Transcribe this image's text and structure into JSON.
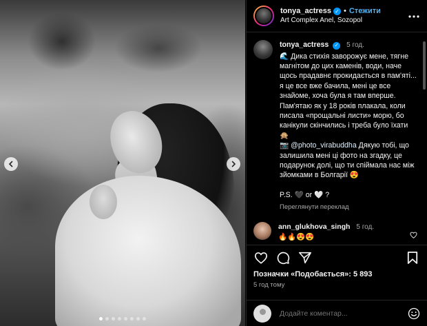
{
  "header": {
    "username": "tonya_actress",
    "separator": "•",
    "follow_label": "Стежити",
    "location": "Art Complex Anel, Sozopol",
    "more_icon": "more-horizontal-icon"
  },
  "carousel": {
    "prev_icon": "chevron-left-icon",
    "next_icon": "chevron-right-icon",
    "slide_count": 8,
    "active_index": 0
  },
  "caption": {
    "username": "tonya_actress",
    "time": "5 год.",
    "text_before_mention": "🌊 Дика стихія заворожує мене, тягне магнітом до цих каменів, води, наче щось прадавнє прокидається в пам'яті... я це все вже бачила, мені це все знайоме, хоча була я там вперше.\nПам'ятаю як у 18 років плакала, коли писала «прощальні листи» морю, бо канікули скінчились і треба було їхати 🙊\n📷 ",
    "mention": "@photo_virabuddha",
    "text_after_mention": " Дякую тобі, що залишила мені ці фото на згадку, це подарунок долі, що ти спіймала нас між зйомками в Болгарії 😍\n\nP.S. 🖤 or 🤍 ?",
    "translate_label": "Переглянути переклад"
  },
  "comments": [
    {
      "username": "ann_glukhova_singh",
      "time": "5 год.",
      "text": "🔥🔥😍😍"
    }
  ],
  "actions": {
    "like_icon": "heart-icon",
    "comment_icon": "comment-icon",
    "share_icon": "send-icon",
    "save_icon": "bookmark-icon"
  },
  "likes_text": "Позначки «Подобається»: 5 893",
  "posted_ago": "5 год тому",
  "add_comment": {
    "placeholder": "Додайте коментар...",
    "emoji_icon": "smiley-icon"
  },
  "colors": {
    "background": "#000000",
    "link": "#4cb5f9",
    "verified": "#0095f6",
    "secondary_text": "#a8a8a8"
  }
}
